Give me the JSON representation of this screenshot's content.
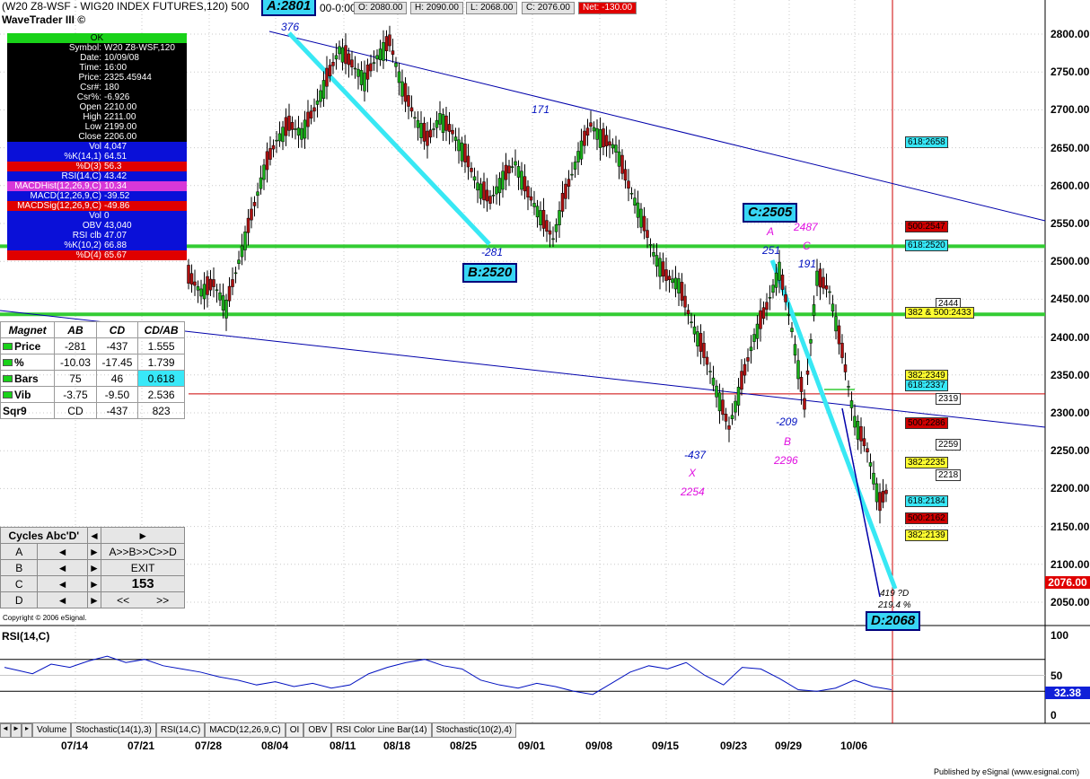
{
  "header": {
    "title": "(W20 Z8-WSF - WIG20 INDEX FUTURES,120) 500",
    "subtitle": "WaveTrader III ©",
    "time_fragment": "00-0:00",
    "open": "O: 2080.00",
    "high": "H: 2090.00",
    "low": "L: 2068.00",
    "close": "C: 2076.00",
    "net": "Net: -130.00"
  },
  "info_panel": {
    "status": "OK",
    "rows": [
      {
        "label": "Symbol:",
        "value": "W20 Z8-WSF,120",
        "style": "k"
      },
      {
        "label": "Date:",
        "value": "10/09/08",
        "style": "k"
      },
      {
        "label": "Time:",
        "value": "16:00",
        "style": "k"
      },
      {
        "label": "Price:",
        "value": "2325.45944",
        "style": "k"
      },
      {
        "label": "Csr#:",
        "value": "180",
        "style": "k"
      },
      {
        "label": "Csr%:",
        "value": "-6.926",
        "style": "k"
      },
      {
        "label": "Open",
        "value": "2210.00",
        "style": "k"
      },
      {
        "label": "High",
        "value": "2211.00",
        "style": "k"
      },
      {
        "label": "Low",
        "value": "2199.00",
        "style": "k"
      },
      {
        "label": "Close",
        "value": "2206.00",
        "style": "k"
      },
      {
        "label": "Vol",
        "value": "4,047",
        "style": "b"
      },
      {
        "label": "%K(14,1)",
        "value": "64.51",
        "style": "b"
      },
      {
        "label": "%D(3)",
        "value": "56.3",
        "style": "r"
      },
      {
        "label": "RSI(14,C)",
        "value": "43.42",
        "style": "b"
      },
      {
        "label": "MACDHist(12,26,9,C)",
        "value": "10.34",
        "style": "m"
      },
      {
        "label": "MACD(12,26,9,C)",
        "value": "-39.52",
        "style": "b"
      },
      {
        "label": "MACDSig(12,26,9,C)",
        "value": "-49.86",
        "style": "r"
      },
      {
        "label": "Vol",
        "value": "0",
        "style": "b"
      },
      {
        "label": "OBV",
        "value": "43,040",
        "style": "b"
      },
      {
        "label": "RSI clb",
        "value": "47.07",
        "style": "b"
      },
      {
        "label": "%K(10,2)",
        "value": "66.88",
        "style": "b"
      },
      {
        "label": "%D(4)",
        "value": "65.67",
        "style": "r"
      }
    ]
  },
  "magnet": {
    "headers": [
      "Magnet",
      "AB",
      "CD",
      "CD/AB"
    ],
    "rows": [
      {
        "label": "Price",
        "dot": true,
        "ab": "-281",
        "cd": "-437",
        "ratio": "1.555",
        "cyan": false
      },
      {
        "label": "%",
        "dot": true,
        "ab": "-10.03",
        "cd": "-17.45",
        "ratio": "1.739",
        "cyan": false
      },
      {
        "label": "Bars",
        "dot": true,
        "ab": "75",
        "cd": "46",
        "ratio": "0.618",
        "cyan": true
      },
      {
        "label": "Vib",
        "dot": true,
        "ab": "-3.75",
        "cd": "-9.50",
        "ratio": "2.536",
        "cyan": false
      },
      {
        "label": "Sqr9",
        "dot": false,
        "ab": "CD",
        "cd": "-437",
        "ratio": "823",
        "cyan": false
      }
    ]
  },
  "cycles": {
    "title": "Cycles Abc'D'",
    "row_labels": [
      "A",
      "B",
      "C",
      "D"
    ],
    "seq_label": "A>>B>>C>>D",
    "exit_label": "EXIT",
    "count": "153",
    "left_nav": "<<",
    "right_nav": ">>"
  },
  "copyright": "Copyright © 2006 eSignal.",
  "price_axis": [
    "2800.00",
    "2750.00",
    "2700.00",
    "2650.00",
    "2600.00",
    "2550.00",
    "2500.00",
    "2450.00",
    "2400.00",
    "2350.00",
    "2300.00",
    "2250.00",
    "2200.00",
    "2150.00",
    "2100.00",
    "2050.00"
  ],
  "current_price": "2076.00",
  "rsi_panel": {
    "title": "RSI(14,C)",
    "axis": [
      "100",
      "50",
      "0"
    ],
    "value": "32.38",
    "series": [
      {
        "t": 0,
        "v": 60
      },
      {
        "t": 3,
        "v": 56
      },
      {
        "t": 6,
        "v": 52
      },
      {
        "t": 10,
        "v": 64
      },
      {
        "t": 14,
        "v": 60
      },
      {
        "t": 18,
        "v": 68
      },
      {
        "t": 22,
        "v": 74
      },
      {
        "t": 26,
        "v": 66
      },
      {
        "t": 30,
        "v": 70
      },
      {
        "t": 34,
        "v": 62
      },
      {
        "t": 38,
        "v": 58
      },
      {
        "t": 42,
        "v": 54
      },
      {
        "t": 46,
        "v": 48
      },
      {
        "t": 50,
        "v": 44
      },
      {
        "t": 54,
        "v": 38
      },
      {
        "t": 58,
        "v": 42
      },
      {
        "t": 62,
        "v": 36
      },
      {
        "t": 66,
        "v": 40
      },
      {
        "t": 70,
        "v": 34
      },
      {
        "t": 74,
        "v": 38
      },
      {
        "t": 78,
        "v": 52
      },
      {
        "t": 82,
        "v": 60
      },
      {
        "t": 86,
        "v": 66
      },
      {
        "t": 90,
        "v": 70
      },
      {
        "t": 94,
        "v": 62
      },
      {
        "t": 98,
        "v": 58
      },
      {
        "t": 102,
        "v": 44
      },
      {
        "t": 106,
        "v": 38
      },
      {
        "t": 110,
        "v": 34
      },
      {
        "t": 114,
        "v": 40
      },
      {
        "t": 118,
        "v": 36
      },
      {
        "t": 122,
        "v": 30
      },
      {
        "t": 126,
        "v": 26
      },
      {
        "t": 130,
        "v": 40
      },
      {
        "t": 134,
        "v": 54
      },
      {
        "t": 138,
        "v": 62
      },
      {
        "t": 142,
        "v": 58
      },
      {
        "t": 146,
        "v": 66
      },
      {
        "t": 150,
        "v": 50
      },
      {
        "t": 154,
        "v": 38
      },
      {
        "t": 158,
        "v": 60
      },
      {
        "t": 162,
        "v": 58
      },
      {
        "t": 166,
        "v": 46
      },
      {
        "t": 170,
        "v": 32
      },
      {
        "t": 174,
        "v": 30
      },
      {
        "t": 178,
        "v": 34
      },
      {
        "t": 182,
        "v": 44
      },
      {
        "t": 186,
        "v": 36
      },
      {
        "t": 190,
        "v": 32
      }
    ]
  },
  "tabs": [
    "Volume",
    "Stochastic(14(1),3)",
    "RSI(14,C)",
    "MACD(12,26,9,C)",
    "OI",
    "OBV",
    "RSI Color Line Bar(14)",
    "Stochastic(10(2),4)"
  ],
  "dates": [
    "07/14",
    "07/21",
    "07/28",
    "08/04",
    "08/11",
    "08/18",
    "08/25",
    "09/01",
    "09/08",
    "09/15",
    "09/23",
    "09/29",
    "10/06"
  ],
  "footer": "Published by eSignal (www.esignal.com)",
  "chart_data": {
    "type": "candlestick",
    "price_range": [
      2025,
      2830
    ],
    "price_ticks": [
      2050,
      2100,
      2150,
      2200,
      2250,
      2300,
      2350,
      2400,
      2450,
      2500,
      2550,
      2600,
      2650,
      2700,
      2750,
      2800
    ],
    "x_range_bars": [
      0,
      200
    ],
    "series": [
      {
        "t": 0,
        "p": 2480
      },
      {
        "t": 4,
        "p": 2460
      },
      {
        "t": 8,
        "p": 2470
      },
      {
        "t": 12,
        "p": 2440
      },
      {
        "t": 16,
        "p": 2500
      },
      {
        "t": 20,
        "p": 2560
      },
      {
        "t": 24,
        "p": 2620
      },
      {
        "t": 28,
        "p": 2660
      },
      {
        "t": 32,
        "p": 2680
      },
      {
        "t": 36,
        "p": 2670
      },
      {
        "t": 40,
        "p": 2700
      },
      {
        "t": 44,
        "p": 2740
      },
      {
        "t": 48,
        "p": 2780
      },
      {
        "t": 52,
        "p": 2760
      },
      {
        "t": 56,
        "p": 2740
      },
      {
        "t": 60,
        "p": 2770
      },
      {
        "t": 64,
        "p": 2790
      },
      {
        "t": 68,
        "p": 2730
      },
      {
        "t": 72,
        "p": 2690
      },
      {
        "t": 76,
        "p": 2660
      },
      {
        "t": 80,
        "p": 2690
      },
      {
        "t": 84,
        "p": 2670
      },
      {
        "t": 88,
        "p": 2640
      },
      {
        "t": 92,
        "p": 2600
      },
      {
        "t": 96,
        "p": 2580
      },
      {
        "t": 100,
        "p": 2610
      },
      {
        "t": 104,
        "p": 2630
      },
      {
        "t": 108,
        "p": 2590
      },
      {
        "t": 112,
        "p": 2560
      },
      {
        "t": 116,
        "p": 2530
      },
      {
        "t": 120,
        "p": 2590
      },
      {
        "t": 124,
        "p": 2640
      },
      {
        "t": 128,
        "p": 2680
      },
      {
        "t": 132,
        "p": 2660
      },
      {
        "t": 136,
        "p": 2650
      },
      {
        "t": 140,
        "p": 2600
      },
      {
        "t": 144,
        "p": 2560
      },
      {
        "t": 148,
        "p": 2510
      },
      {
        "t": 152,
        "p": 2480
      },
      {
        "t": 156,
        "p": 2470
      },
      {
        "t": 160,
        "p": 2420
      },
      {
        "t": 164,
        "p": 2380
      },
      {
        "t": 168,
        "p": 2330
      },
      {
        "t": 172,
        "p": 2280
      },
      {
        "t": 176,
        "p": 2340
      },
      {
        "t": 180,
        "p": 2400
      },
      {
        "t": 184,
        "p": 2440
      },
      {
        "t": 188,
        "p": 2490
      },
      {
        "t": 192,
        "p": 2410
      },
      {
        "t": 196,
        "p": 2310
      },
      {
        "t": 200,
        "p": 2480
      },
      {
        "t": 204,
        "p": 2460
      },
      {
        "t": 208,
        "p": 2380
      },
      {
        "t": 212,
        "p": 2290
      },
      {
        "t": 216,
        "p": 2250
      },
      {
        "t": 220,
        "p": 2180
      },
      {
        "t": 224,
        "p": 2210
      },
      {
        "t": 228,
        "p": 2076
      }
    ],
    "horizontal_lines": [
      {
        "price": 2520,
        "color": "#33cc33"
      },
      {
        "price": 2430,
        "color": "#33cc33"
      },
      {
        "price": 2325,
        "color": "#cc0000"
      }
    ],
    "labels": {
      "A_stamp": "A:2801",
      "B_stamp": "B:2520",
      "C_stamp": "C:2505",
      "D_stamp": "D:2068",
      "point_376": "376",
      "point_281": "-281",
      "point_171": "171",
      "point_437": "-437",
      "point_X": "X",
      "point_2254": "2254",
      "point_251": "251",
      "point_A2": "A",
      "point_2487": "2487",
      "point_C2": "C",
      "point_191": "191",
      "point_209": "-209",
      "point_B2": "B",
      "point_2296": "2296",
      "point_D": "419 ?D",
      "point_pct": "219.4 %"
    },
    "levels": [
      {
        "text": "618:2658",
        "cls": "cy"
      },
      {
        "text": "500:2547",
        "cls": "re"
      },
      {
        "text": "618:2520",
        "cls": "cy"
      },
      {
        "text": "2444",
        "cls": "wh"
      },
      {
        "text": "382 & 500:2433",
        "cls": "ye"
      },
      {
        "text": "382:2349",
        "cls": "ye"
      },
      {
        "text": "618:2337",
        "cls": "cy"
      },
      {
        "text": "2319",
        "cls": "wh"
      },
      {
        "text": "500:2286",
        "cls": "re"
      },
      {
        "text": "2259",
        "cls": "wh"
      },
      {
        "text": "382:2235",
        "cls": "ye"
      },
      {
        "text": "2218",
        "cls": "wh"
      },
      {
        "text": "618:2184",
        "cls": "cy"
      },
      {
        "text": "500:2162",
        "cls": "re"
      },
      {
        "text": "382:2139",
        "cls": "ye"
      }
    ]
  }
}
